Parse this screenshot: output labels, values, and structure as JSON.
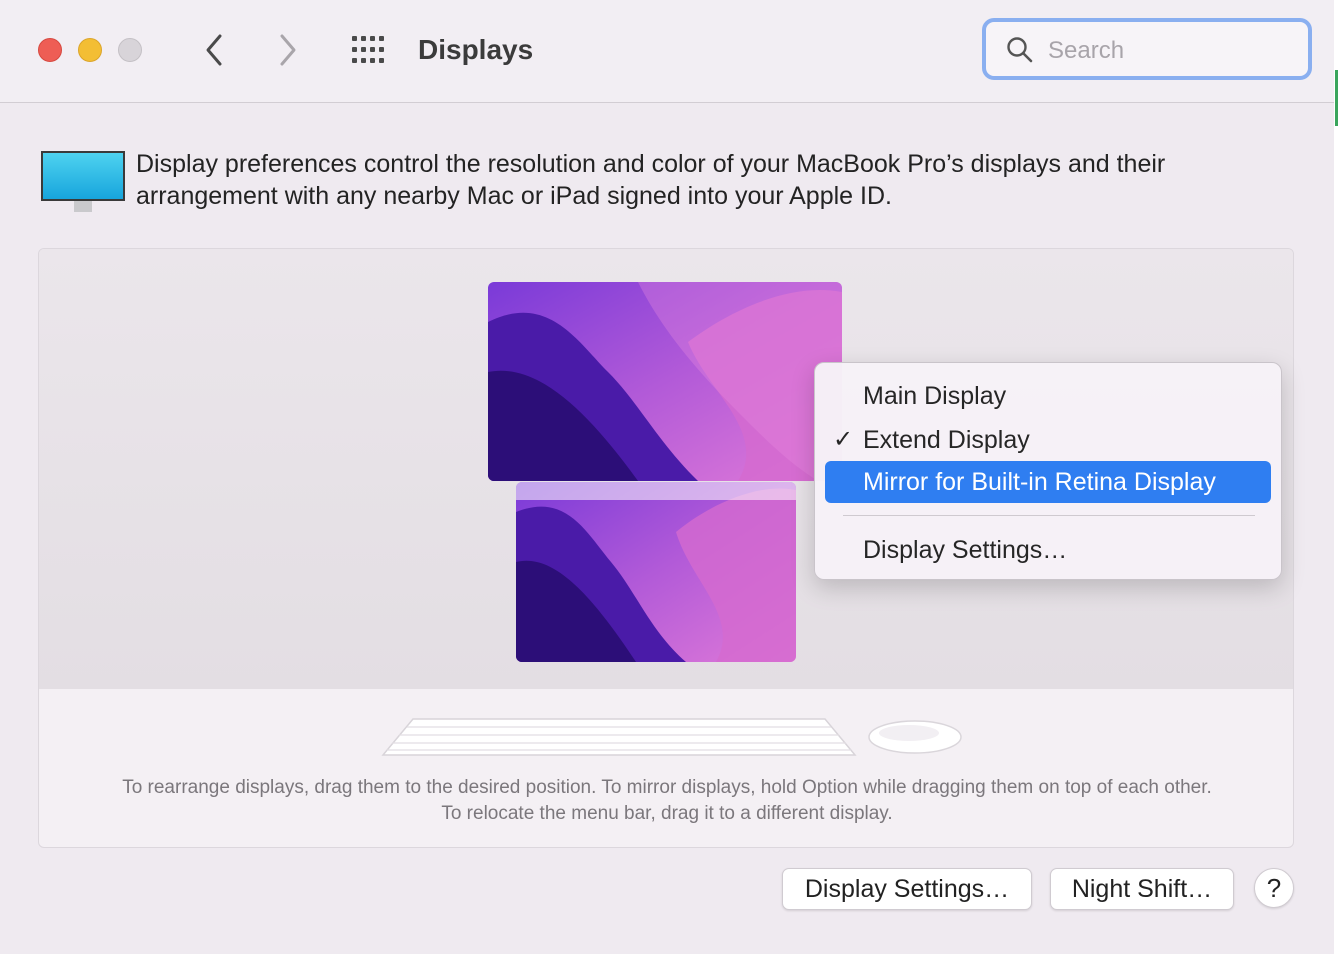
{
  "window": {
    "title": "Displays",
    "search_placeholder": "Search"
  },
  "toolbar": {
    "back_icon": "chevron-left-icon",
    "forward_icon": "chevron-right-icon",
    "grid_icon": "grid-icon"
  },
  "description": "Display preferences control the resolution and color of your MacBook Pro’s displays and their arrangement with any nearby Mac or iPad signed into your Apple ID.",
  "arrangement": {
    "hint": "To rearrange displays, drag them to the desired position. To mirror displays, hold Option while dragging them on top of each other. To relocate the menu bar, drag it to a different display."
  },
  "context_menu": {
    "items": [
      {
        "label": "Main Display",
        "checked": false,
        "selected": false
      },
      {
        "label": "Extend Display",
        "checked": true,
        "selected": false
      },
      {
        "label": "Mirror for Built-in Retina Display",
        "checked": false,
        "selected": true
      },
      {
        "label": "Display Settings…",
        "checked": false,
        "selected": false
      }
    ],
    "check_mark": "✓"
  },
  "buttons": {
    "display_settings": "Display Settings…",
    "night_shift": "Night Shift…",
    "help": "?"
  },
  "colors": {
    "accent": "#2f7ef1",
    "search_focus": "#8aaff0"
  }
}
